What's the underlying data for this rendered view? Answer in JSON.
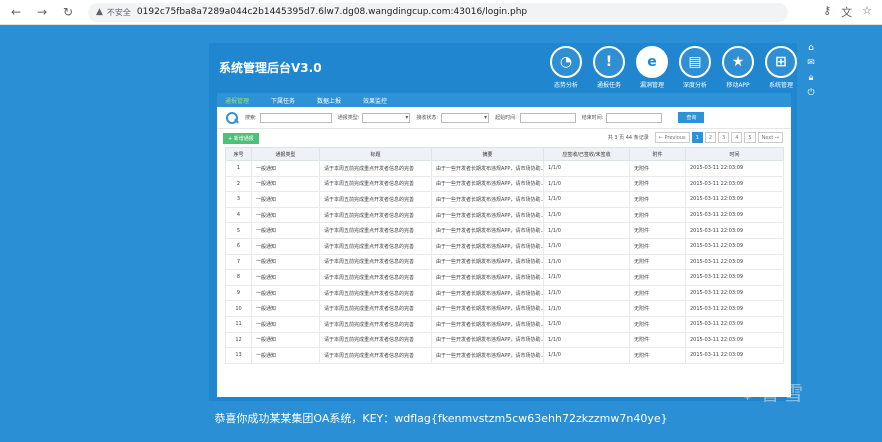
{
  "browser": {
    "warning_label": "不安全",
    "url": "0192c75fba8a7289a044c2b1445395d7.6lw7.dg08.wangdingcup.com:43016/login.php"
  },
  "app": {
    "title": "系统管理后台V3.0",
    "topnav": [
      {
        "label": "态势分析",
        "icon": "pie-chart-icon",
        "glyph": "◔"
      },
      {
        "label": "通报任务",
        "icon": "warning-icon",
        "glyph": "!"
      },
      {
        "label": "漏洞管理",
        "icon": "ie-icon",
        "glyph": "e",
        "active": true
      },
      {
        "label": "深度分析",
        "icon": "monitor-icon",
        "glyph": "▤"
      },
      {
        "label": "移动APP",
        "icon": "star-badge-icon",
        "glyph": "★"
      },
      {
        "label": "系统管理",
        "icon": "window-icon",
        "glyph": "⊞"
      }
    ],
    "tabs": [
      "通报管理",
      "下属任务",
      "数据上报",
      "效果监控"
    ],
    "filter": {
      "search_label": "搜索:",
      "type_label": "通报类型:",
      "status_label": "接收状态:",
      "start_label": "起始时间:",
      "end_label": "结束时间:",
      "query_button": "查询"
    },
    "add_button": "+ 新增通报",
    "pager": {
      "summary": "共 3 页 44 条记录",
      "prev": "← Previous",
      "pages": [
        "1",
        "2",
        "3",
        "4",
        "5"
      ],
      "current": "1",
      "next": "Next →"
    },
    "table": {
      "headers": [
        "序号",
        "通报类型",
        "标题",
        "摘要",
        "应签收/已签收/未签收",
        "附件",
        "时间"
      ],
      "rows": [
        [
          "1",
          "一般通知",
          "请于本周五前完成重点开发者信息的完善",
          "由于一些开发者长期发布违规APP，请市场协助...",
          "1/1/0",
          "无附件",
          "2015-03-11 22:03:09"
        ],
        [
          "2",
          "一般通知",
          "请于本周五前完成重点开发者信息的完善",
          "由于一些开发者长期发布违规APP，请市场协助...",
          "1/1/0",
          "无附件",
          "2015-03-11 22:03:09"
        ],
        [
          "3",
          "一般通知",
          "请于本周五前完成重点开发者信息的完善",
          "由于一些开发者长期发布违规APP，请市场协助...",
          "1/1/0",
          "无附件",
          "2015-03-11 22:03:09"
        ],
        [
          "4",
          "一般通知",
          "请于本周五前完成重点开发者信息的完善",
          "由于一些开发者长期发布违规APP，请市场协助...",
          "1/1/0",
          "无附件",
          "2015-03-11 22:03:09"
        ],
        [
          "5",
          "一般通知",
          "请于本周五前完成重点开发者信息的完善",
          "由于一些开发者长期发布违规APP，请市场协助...",
          "1/1/0",
          "无附件",
          "2015-03-11 22:03:09"
        ],
        [
          "6",
          "一般通知",
          "请于本周五前完成重点开发者信息的完善",
          "由于一些开发者长期发布违规APP，请市场协助...",
          "1/1/0",
          "无附件",
          "2015-03-11 22:03:09"
        ],
        [
          "7",
          "一般通知",
          "请于本周五前完成重点开发者信息的完善",
          "由于一些开发者长期发布违规APP，请市场协助...",
          "1/1/0",
          "无附件",
          "2015-03-11 22:03:09"
        ],
        [
          "8",
          "一般通知",
          "请于本周五前完成重点开发者信息的完善",
          "由于一些开发者长期发布违规APP，请市场协助...",
          "1/1/0",
          "无附件",
          "2015-03-11 22:03:09"
        ],
        [
          "9",
          "一般通知",
          "请于本周五前完成重点开发者信息的完善",
          "由于一些开发者长期发布违规APP，请市场协助...",
          "1/1/0",
          "无附件",
          "2015-03-11 22:03:09"
        ],
        [
          "10",
          "一般通知",
          "请于本周五前完成重点开发者信息的完善",
          "由于一些开发者长期发布违规APP，请市场协助...",
          "1/1/0",
          "无附件",
          "2015-03-11 22:03:09"
        ],
        [
          "11",
          "一般通知",
          "请于本周五前完成重点开发者信息的完善",
          "由于一些开发者长期发布违规APP，请市场协助...",
          "1/1/0",
          "无附件",
          "2015-03-11 22:03:09"
        ],
        [
          "12",
          "一般通知",
          "请于本周五前完成重点开发者信息的完善",
          "由于一些开发者长期发布违规APP，请市场协助...",
          "1/1/0",
          "无附件",
          "2015-03-11 22:03:09"
        ],
        [
          "13",
          "一般通知",
          "请于本周五前完成重点开发者信息的完善",
          "由于一些开发者长期发布违规APP，请市场协助...",
          "1/1/0",
          "无附件",
          "2015-03-11 22:03:09"
        ]
      ]
    }
  },
  "footer_message": "恭喜你成功某某集团OA系统，KEY：wdflag{fkenmvstzm5cw63ehh72zkzzmw7n40ye}",
  "watermark": "看雪"
}
